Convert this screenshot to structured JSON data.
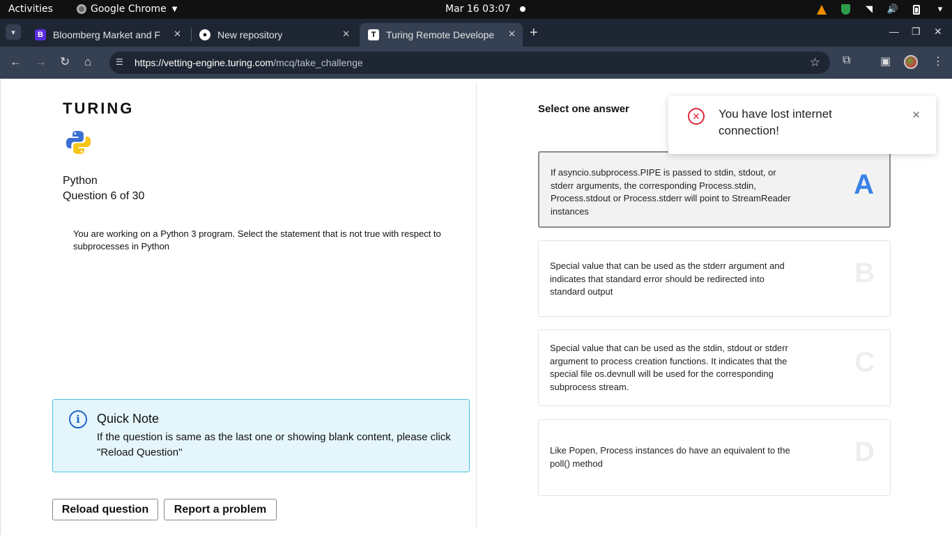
{
  "os_bar": {
    "activities": "Activities",
    "app_name": "Google Chrome",
    "datetime": "Mar 16  03:07"
  },
  "tabs": [
    {
      "title": "Bloomberg Market and F",
      "favicon": "bloomberg-icon"
    },
    {
      "title": "New repository",
      "favicon": "github-icon"
    },
    {
      "title": "Turing Remote Develope",
      "favicon": "turing-icon",
      "active": true
    }
  ],
  "address_bar": {
    "host": "https://vetting-engine.turing.com",
    "path": "/mcq/take_challenge"
  },
  "sidebar": {
    "logo": "TURING",
    "language": "Python",
    "question_counter": "Question 6 of 30",
    "question": "You are working on a Python 3 program. Select the statement that is not true with respect to subprocesses in Python"
  },
  "note": {
    "title": "Quick Note",
    "body": "If the question is same as the last one or showing blank content, please click \"Reload Question\""
  },
  "buttons": {
    "reload": "Reload question",
    "report": "Report a problem"
  },
  "answers": {
    "label": "Select one answer",
    "options": [
      {
        "letter": "A",
        "text": "If asyncio.subprocess.PIPE is passed to stdin, stdout, or stderr arguments, the corresponding Process.stdin, Process.stdout or Process.stderr will point to StreamReader instances",
        "selected": true
      },
      {
        "letter": "B",
        "text": "Special value that can be used as the stderr argument and indicates that standard error should be redirected into standard output",
        "selected": false
      },
      {
        "letter": "C",
        "text": "Special value that can be used as the stdin, stdout or stderr argument to process creation functions. It indicates that the special file os.devnull will be used for the corresponding subprocess stream.",
        "selected": false
      },
      {
        "letter": "D",
        "text": "Like Popen, Process instances do have an equivalent to the poll() method",
        "selected": false
      }
    ]
  },
  "toast": {
    "message": "You have lost internet connection!"
  },
  "colors": {
    "accent": "#3b82e6",
    "error": "#e0243a",
    "note_bg": "#e4f6fb"
  }
}
